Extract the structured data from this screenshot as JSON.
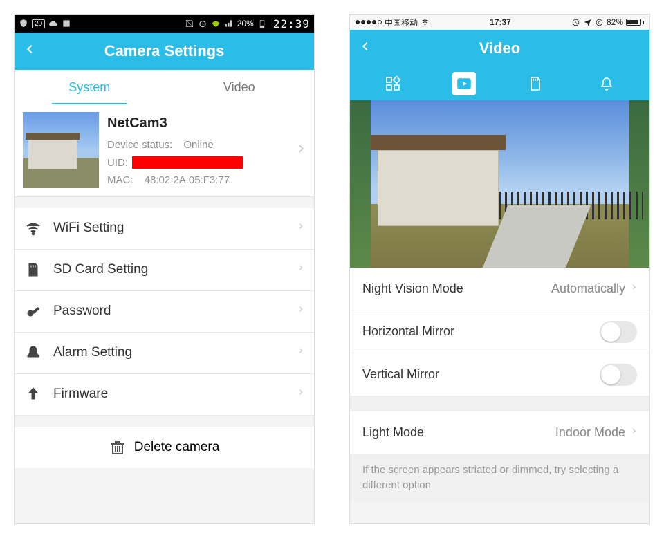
{
  "left": {
    "status": {
      "battery_pct": "20%",
      "time": "22:39"
    },
    "header": {
      "title": "Camera Settings"
    },
    "tabs": {
      "system": "System",
      "video": "Video",
      "active": "system"
    },
    "device": {
      "name": "NetCam3",
      "status_label": "Device status:",
      "status_value": "Online",
      "uid_label": "UID:",
      "mac_label": "MAC:",
      "mac_value": "48:02:2A:05:F3:77"
    },
    "items": {
      "wifi": "WiFi Setting",
      "sd": "SD Card Setting",
      "password": "Password",
      "alarm": "Alarm Setting",
      "firmware": "Firmware"
    },
    "delete_label": "Delete camera"
  },
  "right": {
    "status": {
      "carrier": "中国移动",
      "time": "17:37",
      "battery_pct": "82%"
    },
    "header": {
      "title": "Video"
    },
    "rows": {
      "night_label": "Night Vision Mode",
      "night_value": "Automatically",
      "hmirror": "Horizontal Mirror",
      "vmirror": "Vertical Mirror",
      "light_label": "Light Mode",
      "light_value": "Indoor Mode"
    },
    "hint": "If the screen appears striated or dimmed, try selecting a different option"
  }
}
